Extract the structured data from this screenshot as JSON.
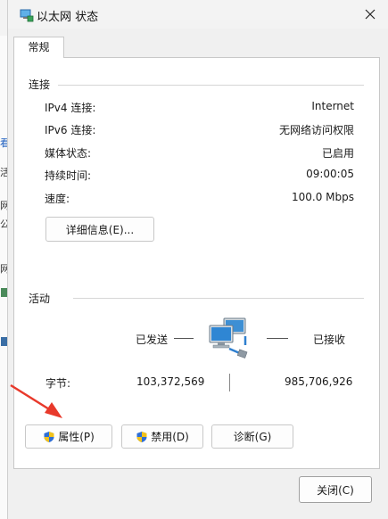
{
  "background": {
    "chars": [
      "看",
      "活",
      "网",
      "公",
      "网"
    ]
  },
  "window": {
    "title": "以太网 状态"
  },
  "tabs": {
    "general": "常规"
  },
  "connection": {
    "heading": "连接",
    "rows": [
      {
        "label": "IPv4 连接:",
        "value": "Internet"
      },
      {
        "label": "IPv6 连接:",
        "value": "无网络访问权限"
      },
      {
        "label": "媒体状态:",
        "value": "已启用"
      },
      {
        "label": "持续时间:",
        "value": "09:00:05"
      },
      {
        "label": "速度:",
        "value": "100.0 Mbps"
      }
    ],
    "details_button": "详细信息(E)..."
  },
  "activity": {
    "heading": "活动",
    "sent_label": "已发送",
    "received_label": "已接收",
    "bytes_label": "字节:",
    "bytes_sent": "103,372,569",
    "bytes_received": "985,706,926"
  },
  "buttons": {
    "properties": "属性(P)",
    "disable": "禁用(D)",
    "diagnose": "诊断(G)",
    "close": "关闭(C)"
  },
  "colors": {
    "annotation_arrow": "#e8392b",
    "shield_blue": "#2f6fd6",
    "shield_yellow": "#f2c21b"
  }
}
